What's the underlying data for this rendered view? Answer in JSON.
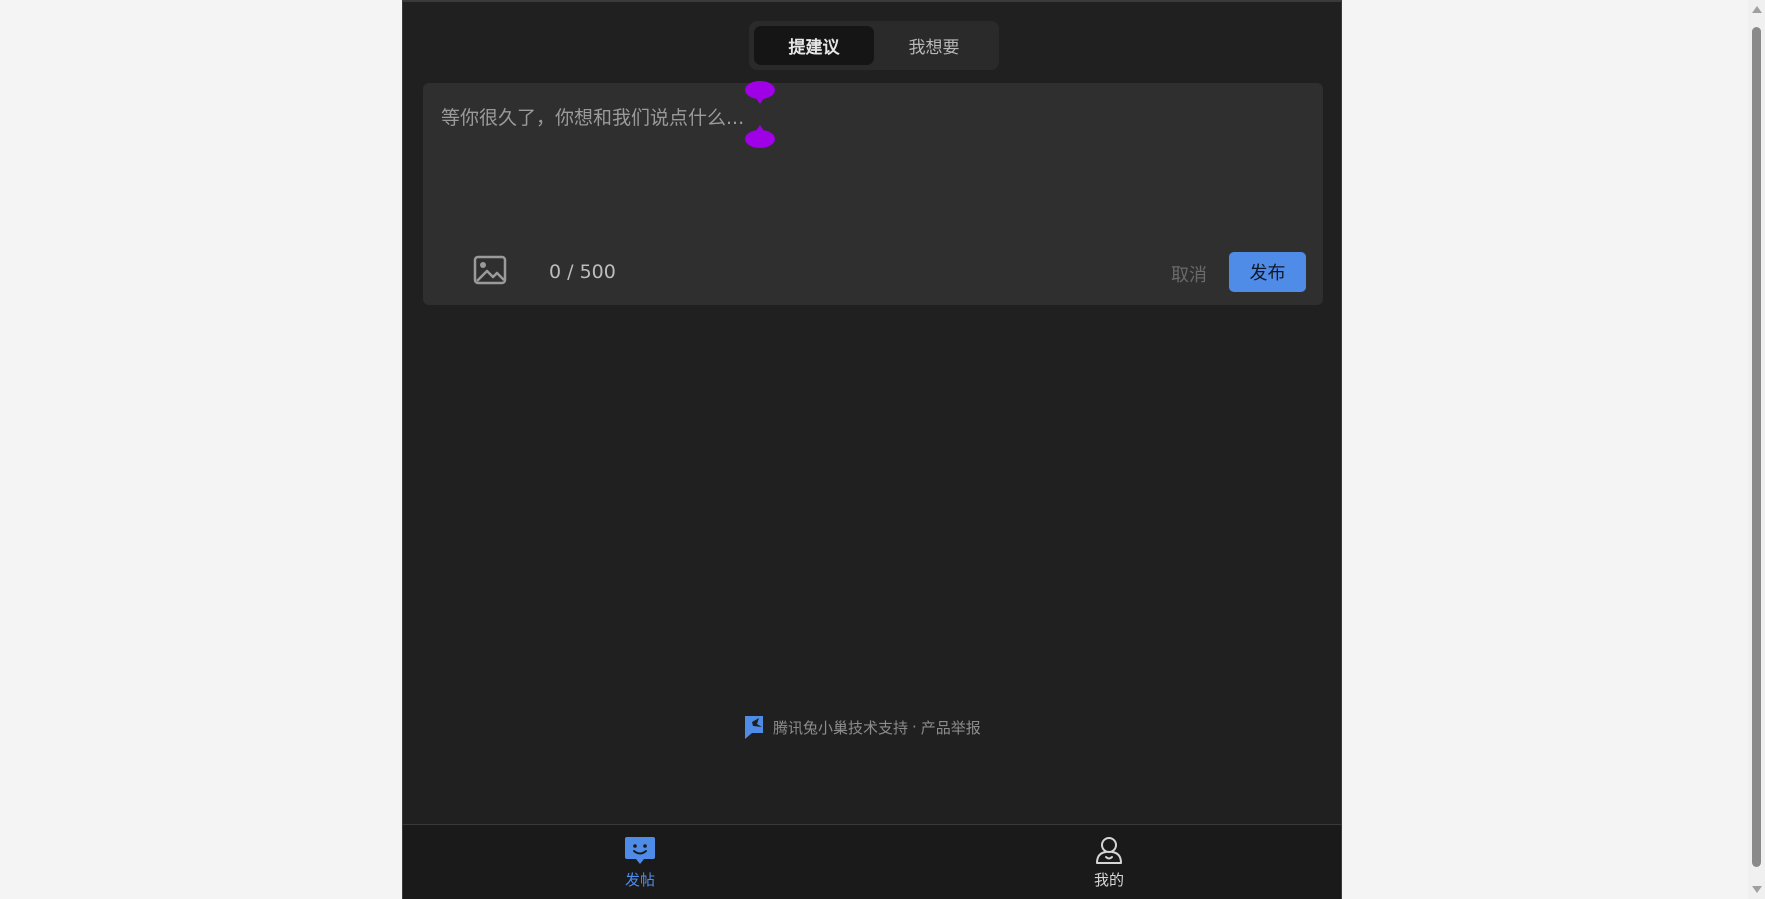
{
  "tabs": [
    {
      "label": "提建议",
      "active": true
    },
    {
      "label": "我想要",
      "active": false
    }
  ],
  "composer": {
    "placeholder": "等你很久了，你想和我们说点什么...",
    "value": "",
    "counter": "0 / 500",
    "image_icon": "image-icon",
    "cancel_label": "取消",
    "publish_label": "发布"
  },
  "footer": {
    "logo_icon": "tencent-txc-logo-icon",
    "support_text": "腾讯兔小巢技术支持",
    "separator": "·",
    "report_text": "产品举报"
  },
  "bottom_nav": [
    {
      "label": "发帖",
      "icon": "chat-smile-icon",
      "active": true
    },
    {
      "label": "我的",
      "icon": "user-icon",
      "active": false
    }
  ],
  "colors": {
    "accent": "#4f8ce8",
    "selection_handle": "#a000e6",
    "background": "#202020",
    "card": "#2f2f2f"
  }
}
